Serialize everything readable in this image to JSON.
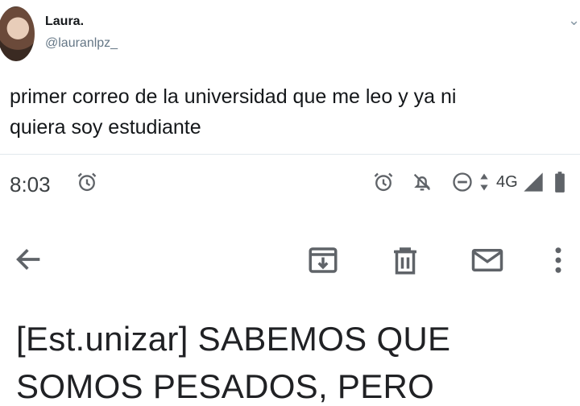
{
  "tweet": {
    "author_name": "Laura.",
    "author_handle": "@lauranlpz_",
    "text": "primer correo de la universidad que me leo y ya ni\nquiera soy estudiante"
  },
  "phone_status": {
    "time": "8:03",
    "network": "4G"
  },
  "icons": {
    "alarm": "alarm-icon",
    "bell_off": "bell-off-icon",
    "dnd": "do-not-disturb-icon",
    "signal": "signal-icon",
    "battery": "battery-icon",
    "back": "arrow-back-icon",
    "archive": "archive-icon",
    "delete": "trash-icon",
    "mail": "mark-unread-icon",
    "more": "more-vert-icon"
  },
  "email": {
    "subject_line1": "[Est.unizar] SABEMOS QUE",
    "subject_line2": "SOMOS PESADOS, PERO"
  },
  "colors": {
    "icon_gray": "#5f6368",
    "text_dark": "#202124",
    "twitter_gray": "#657786"
  }
}
